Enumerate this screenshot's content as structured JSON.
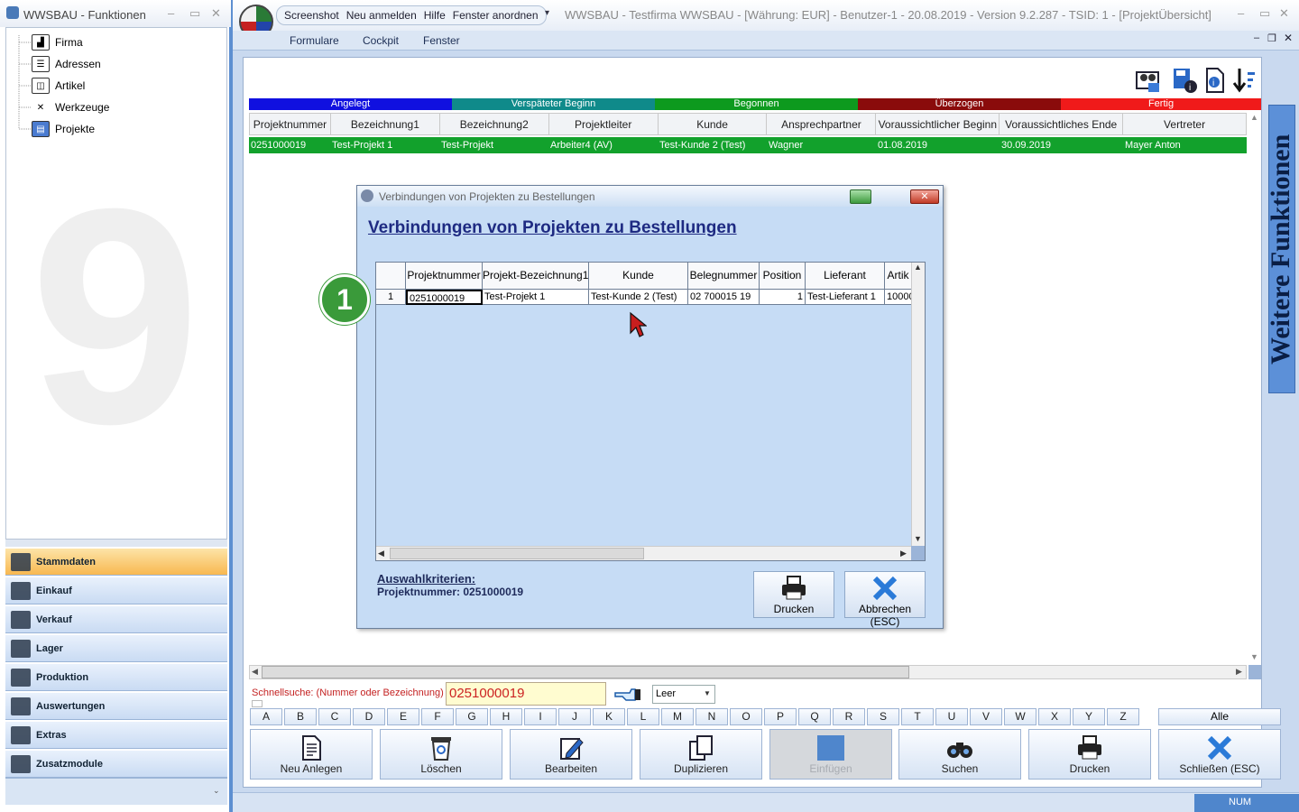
{
  "left": {
    "title": "WWSBAU - Funktionen",
    "tree": [
      {
        "label": "Firma",
        "icon": "factory-icon"
      },
      {
        "label": "Adressen",
        "icon": "address-card-icon"
      },
      {
        "label": "Artikel",
        "icon": "box-icon"
      },
      {
        "label": "Werkzeuge",
        "icon": "tools-icon"
      },
      {
        "label": "Projekte",
        "icon": "project-icon"
      }
    ],
    "nav": [
      "Stammdaten",
      "Einkauf",
      "Verkauf",
      "Lager",
      "Produktion",
      "Auswertungen",
      "Extras",
      "Zusatzmodule"
    ],
    "nav_selected": "Stammdaten"
  },
  "main": {
    "qat": [
      "Screenshot",
      "Neu anmelden",
      "Hilfe",
      "Fenster anordnen"
    ],
    "title": "WWSBAU - Testfirma WWSBAU - [Währung: EUR] - Benutzer-1 - 20.08.2019 - Version 9.2.287 - TSID: 1  - [ProjektÜbersicht]",
    "ribbon_tabs": [
      "Formulare",
      "Cockpit",
      "Fenster"
    ],
    "status_legend": [
      {
        "label": "Angelegt",
        "color": "#1010e0"
      },
      {
        "label": "Verspäteter Beginn",
        "color": "#0f8a8a"
      },
      {
        "label": "Begonnen",
        "color": "#0d9a1e"
      },
      {
        "label": "Überzogen",
        "color": "#8a0b0b"
      },
      {
        "label": "Fertig",
        "color": "#f01a1a"
      }
    ],
    "grid_headers": [
      "Projektnummer",
      "Bezeichnung1",
      "Bezeichnung2",
      "Projektleiter",
      "Kunde",
      "Ansprechpartner",
      "Voraussichtlicher Beginn",
      "Voraussichtliches Ende",
      "Vertreter"
    ],
    "grid_rows": [
      [
        "0251000019",
        "Test-Projekt 1",
        "Test-Projekt",
        "Arbeiter4 (AV)",
        "Test-Kunde 2  (Test)",
        "Wagner",
        "01.08.2019",
        "30.09.2019",
        "Mayer Anton"
      ]
    ],
    "side_panel": "Weitere Funktionen",
    "quicksearch": {
      "label": "Schnellsuche: (Nummer oder Bezeichnung) :",
      "value": "0251000019",
      "filter": "Leer"
    },
    "letters": [
      "A",
      "B",
      "C",
      "D",
      "E",
      "F",
      "G",
      "H",
      "I",
      "J",
      "K",
      "L",
      "M",
      "N",
      "O",
      "P",
      "Q",
      "R",
      "S",
      "T",
      "U",
      "V",
      "W",
      "X",
      "Y",
      "Z"
    ],
    "all_label": "Alle",
    "buttons": [
      {
        "label": "Neu Anlegen",
        "icon": "document-icon"
      },
      {
        "label": "Löschen",
        "icon": "trash-icon"
      },
      {
        "label": "Bearbeiten",
        "icon": "edit-icon"
      },
      {
        "label": "Duplizieren",
        "icon": "copy-icon"
      },
      {
        "label": "Einfügen",
        "icon": "paste-icon"
      },
      {
        "label": "Suchen",
        "icon": "binoculars-icon"
      },
      {
        "label": "Drucken",
        "icon": "printer-icon"
      },
      {
        "label": "Schließen (ESC)",
        "icon": "close-icon"
      }
    ],
    "status_num": "NUM"
  },
  "dialog": {
    "title": "Verbindungen von Projekten zu Bestellungen",
    "heading": "Verbindungen von Projekten zu Bestellungen",
    "headers": [
      "",
      "Projektnummer",
      "Projekt-Bezeichnung1",
      "Kunde",
      "Belegnummer",
      "Position",
      "Lieferant",
      "Artik"
    ],
    "rows": [
      [
        "1",
        "0251000019",
        "Test-Projekt 1",
        "Test-Kunde 2  (Test)",
        "02 700015 19",
        "1",
        "Test-Lieferant 1",
        "10000"
      ]
    ],
    "criteria_title": "Auswahlkriterien:",
    "criteria_value": "Projektnummer: 0251000019",
    "print_label": "Drucken",
    "cancel_label": "Abbrechen (ESC)"
  },
  "badge": "1"
}
